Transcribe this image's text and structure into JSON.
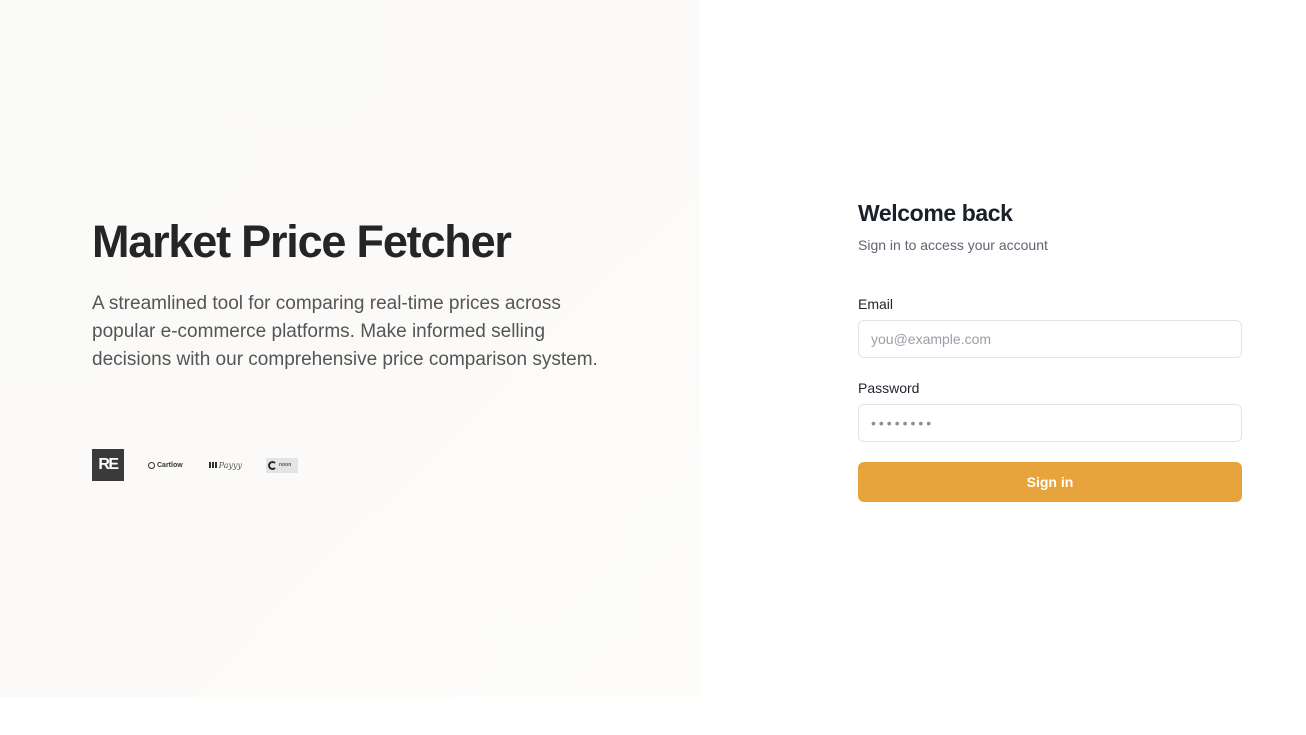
{
  "hero": {
    "title": "Market Price Fetcher",
    "description": "A streamlined tool for comparing real-time prices across popular e-commerce platforms. Make informed selling decisions with our comprehensive price comparison system.",
    "logos": {
      "re": "RE",
      "cartlow": "Cartlow",
      "payyy": "Payyy",
      "noon": "noon"
    }
  },
  "login": {
    "title": "Welcome back",
    "subtitle": "Sign in to access your account",
    "email_label": "Email",
    "email_placeholder": "you@example.com",
    "password_label": "Password",
    "password_placeholder": "••••••••",
    "signin_label": "Sign in"
  },
  "colors": {
    "accent": "#e8a43c",
    "title_text": "#252525",
    "left_background": "#fafaf8"
  }
}
